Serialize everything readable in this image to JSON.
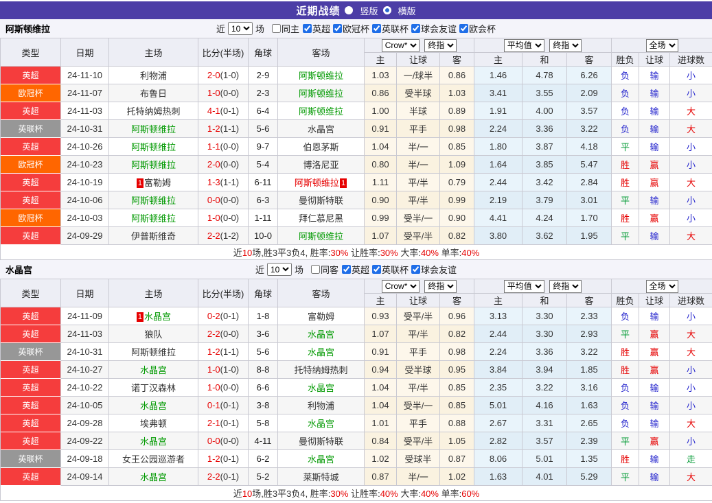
{
  "title_bar": {
    "title": "近期战绩",
    "vertical_label": "竖版",
    "horizontal_label": "横版",
    "vertical_selected": true
  },
  "table": {
    "columns": [
      "类型",
      "日期",
      "主场",
      "比分(半场)",
      "角球",
      "客场",
      "主",
      "让球",
      "客",
      "主",
      "和",
      "客",
      "胜负",
      "让球",
      "进球数"
    ],
    "dropdowns": [
      "Crow*",
      "终指",
      "平均值",
      "终指",
      "全场"
    ]
  },
  "filter_labels": {
    "near": "近",
    "matches": "场"
  },
  "colors": {
    "titlebar_purple": "#4c3da6",
    "epl_red": "#f53d3d",
    "ucl_orange": "#ff6600",
    "eflcup_gray": "#979797",
    "team_green": "#009900",
    "score_red": "#e60000",
    "result_blue": "#2323cd",
    "result_green": "#009933",
    "result_red": "#e60000",
    "handicap_col_bg": "#fdf7eb",
    "average_col_bg": "#e9f4fb"
  },
  "sections": [
    {
      "team": "阿斯顿维拉",
      "filter": {
        "count": "10",
        "same": "同主",
        "same_checked": false,
        "leagues": [
          {
            "label": "英超",
            "checked": true
          },
          {
            "label": "欧冠杯",
            "checked": true
          },
          {
            "label": "英联杯",
            "checked": true
          },
          {
            "label": "球会友谊",
            "checked": true
          },
          {
            "label": "欧会杯",
            "checked": true
          }
        ]
      },
      "rows": [
        {
          "league": "英超",
          "league_type": "epl",
          "date": "24-11-10",
          "home": {
            "name": "利物浦",
            "color": "dark"
          },
          "score_ft": "2-0",
          "score_ht": "(1-0)",
          "corner": "2-9",
          "away": {
            "name": "阿斯顿维拉",
            "color": "green"
          },
          "odds": [
            "1.03",
            "一/球半",
            "0.86"
          ],
          "avg": [
            "1.46",
            "4.78",
            "6.26"
          ],
          "results": [
            [
              "负",
              "blue"
            ],
            [
              "输",
              "blue"
            ],
            [
              "小",
              "blue"
            ]
          ]
        },
        {
          "league": "欧冠杯",
          "league_type": "ucl",
          "date": "24-11-07",
          "home": {
            "name": "布鲁日",
            "color": "dark"
          },
          "score_ft": "1-0",
          "score_ht": "(0-0)",
          "corner": "2-3",
          "away": {
            "name": "阿斯顿维拉",
            "color": "green"
          },
          "odds": [
            "0.86",
            "受半球",
            "1.03"
          ],
          "avg": [
            "3.41",
            "3.55",
            "2.09"
          ],
          "results": [
            [
              "负",
              "blue"
            ],
            [
              "输",
              "blue"
            ],
            [
              "小",
              "blue"
            ]
          ]
        },
        {
          "league": "英超",
          "league_type": "epl",
          "date": "24-11-03",
          "home": {
            "name": "托特纳姆热刺",
            "color": "dark"
          },
          "score_ft": "4-1",
          "score_ht": "(0-1)",
          "corner": "6-4",
          "away": {
            "name": "阿斯顿维拉",
            "color": "green"
          },
          "odds": [
            "1.00",
            "半球",
            "0.89"
          ],
          "avg": [
            "1.91",
            "4.00",
            "3.57"
          ],
          "results": [
            [
              "负",
              "blue"
            ],
            [
              "输",
              "blue"
            ],
            [
              "大",
              "red"
            ]
          ]
        },
        {
          "league": "英联杯",
          "league_type": "efl",
          "date": "24-10-31",
          "home": {
            "name": "阿斯顿维拉",
            "color": "green"
          },
          "score_ft": "1-2",
          "score_ht": "(1-1)",
          "corner": "5-6",
          "away": {
            "name": "水晶宫",
            "color": "dark"
          },
          "odds": [
            "0.91",
            "平手",
            "0.98"
          ],
          "avg": [
            "2.24",
            "3.36",
            "3.22"
          ],
          "results": [
            [
              "负",
              "blue"
            ],
            [
              "输",
              "blue"
            ],
            [
              "大",
              "red"
            ]
          ]
        },
        {
          "league": "英超",
          "league_type": "epl",
          "date": "24-10-26",
          "home": {
            "name": "阿斯顿维拉",
            "color": "green"
          },
          "score_ft": "1-1",
          "score_ht": "(0-0)",
          "corner": "9-7",
          "away": {
            "name": "伯恩茅斯",
            "color": "dark"
          },
          "odds": [
            "1.04",
            "半/一",
            "0.85"
          ],
          "avg": [
            "1.80",
            "3.87",
            "4.18"
          ],
          "results": [
            [
              "平",
              "green"
            ],
            [
              "输",
              "blue"
            ],
            [
              "小",
              "blue"
            ]
          ]
        },
        {
          "league": "欧冠杯",
          "league_type": "ucl",
          "date": "24-10-23",
          "home": {
            "name": "阿斯顿维拉",
            "color": "green"
          },
          "score_ft": "2-0",
          "score_ht": "(0-0)",
          "corner": "5-4",
          "away": {
            "name": "博洛尼亚",
            "color": "dark"
          },
          "odds": [
            "0.80",
            "半/一",
            "1.09"
          ],
          "avg": [
            "1.64",
            "3.85",
            "5.47"
          ],
          "results": [
            [
              "胜",
              "red"
            ],
            [
              "赢",
              "red"
            ],
            [
              "小",
              "blue"
            ]
          ]
        },
        {
          "league": "英超",
          "league_type": "epl",
          "date": "24-10-19",
          "home": {
            "name": "富勒姆",
            "color": "dark",
            "badge_before": "1"
          },
          "score_ft": "1-3",
          "score_ht": "(1-1)",
          "corner": "6-11",
          "away": {
            "name": "阿斯顿维拉",
            "color": "red",
            "badge_after": "1"
          },
          "odds": [
            "1.11",
            "平/半",
            "0.79"
          ],
          "avg": [
            "2.44",
            "3.42",
            "2.84"
          ],
          "results": [
            [
              "胜",
              "red"
            ],
            [
              "赢",
              "red"
            ],
            [
              "大",
              "red"
            ]
          ]
        },
        {
          "league": "英超",
          "league_type": "epl",
          "date": "24-10-06",
          "home": {
            "name": "阿斯顿维拉",
            "color": "green"
          },
          "score_ft": "0-0",
          "score_ht": "(0-0)",
          "corner": "6-3",
          "away": {
            "name": "曼彻斯特联",
            "color": "dark"
          },
          "odds": [
            "0.90",
            "平/半",
            "0.99"
          ],
          "avg": [
            "2.19",
            "3.79",
            "3.01"
          ],
          "results": [
            [
              "平",
              "green"
            ],
            [
              "输",
              "blue"
            ],
            [
              "小",
              "blue"
            ]
          ]
        },
        {
          "league": "欧冠杯",
          "league_type": "ucl",
          "date": "24-10-03",
          "home": {
            "name": "阿斯顿维拉",
            "color": "green"
          },
          "score_ft": "1-0",
          "score_ht": "(0-0)",
          "corner": "1-11",
          "away": {
            "name": "拜仁慕尼黑",
            "color": "dark"
          },
          "odds": [
            "0.99",
            "受半/一",
            "0.90"
          ],
          "avg": [
            "4.41",
            "4.24",
            "1.70"
          ],
          "results": [
            [
              "胜",
              "red"
            ],
            [
              "赢",
              "red"
            ],
            [
              "小",
              "blue"
            ]
          ]
        },
        {
          "league": "英超",
          "league_type": "epl",
          "date": "24-09-29",
          "home": {
            "name": "伊普斯维奇",
            "color": "dark"
          },
          "score_ft": "2-2",
          "score_ht": "(1-2)",
          "corner": "10-0",
          "away": {
            "name": "阿斯顿维拉",
            "color": "green"
          },
          "odds": [
            "1.07",
            "受平/半",
            "0.82"
          ],
          "avg": [
            "3.80",
            "3.62",
            "1.95"
          ],
          "results": [
            [
              "平",
              "green"
            ],
            [
              "输",
              "blue"
            ],
            [
              "大",
              "red"
            ]
          ]
        }
      ],
      "summary": [
        [
          "近",
          0
        ],
        [
          "10",
          1
        ],
        [
          "场,胜3平3负4, 胜率:",
          0
        ],
        [
          "30%",
          1
        ],
        [
          " 让胜率:",
          0
        ],
        [
          "30%",
          1
        ],
        [
          " 大率:",
          0
        ],
        [
          "40%",
          1
        ],
        [
          " 单率:",
          0
        ],
        [
          "40%",
          1
        ]
      ]
    },
    {
      "team": "水晶宫",
      "filter": {
        "count": "10",
        "same": "同客",
        "same_checked": false,
        "leagues": [
          {
            "label": "英超",
            "checked": true
          },
          {
            "label": "英联杯",
            "checked": true
          },
          {
            "label": "球会友谊",
            "checked": true
          }
        ]
      },
      "rows": [
        {
          "league": "英超",
          "league_type": "epl",
          "date": "24-11-09",
          "home": {
            "name": "水晶宫",
            "color": "green",
            "badge_before": "1"
          },
          "score_ft": "0-2",
          "score_ht": "(0-1)",
          "corner": "1-8",
          "away": {
            "name": "富勒姆",
            "color": "dark"
          },
          "odds": [
            "0.93",
            "受平/半",
            "0.96"
          ],
          "avg": [
            "3.13",
            "3.30",
            "2.33"
          ],
          "results": [
            [
              "负",
              "blue"
            ],
            [
              "输",
              "blue"
            ],
            [
              "小",
              "blue"
            ]
          ]
        },
        {
          "league": "英超",
          "league_type": "epl",
          "date": "24-11-03",
          "home": {
            "name": "狼队",
            "color": "dark"
          },
          "score_ft": "2-2",
          "score_ht": "(0-0)",
          "corner": "3-6",
          "away": {
            "name": "水晶宫",
            "color": "green"
          },
          "odds": [
            "1.07",
            "平/半",
            "0.82"
          ],
          "avg": [
            "2.44",
            "3.30",
            "2.93"
          ],
          "results": [
            [
              "平",
              "green"
            ],
            [
              "赢",
              "red"
            ],
            [
              "大",
              "red"
            ]
          ]
        },
        {
          "league": "英联杯",
          "league_type": "efl",
          "date": "24-10-31",
          "home": {
            "name": "阿斯顿维拉",
            "color": "dark"
          },
          "score_ft": "1-2",
          "score_ht": "(1-1)",
          "corner": "5-6",
          "away": {
            "name": "水晶宫",
            "color": "green"
          },
          "odds": [
            "0.91",
            "平手",
            "0.98"
          ],
          "avg": [
            "2.24",
            "3.36",
            "3.22"
          ],
          "results": [
            [
              "胜",
              "red"
            ],
            [
              "赢",
              "red"
            ],
            [
              "大",
              "red"
            ]
          ]
        },
        {
          "league": "英超",
          "league_type": "epl",
          "date": "24-10-27",
          "home": {
            "name": "水晶宫",
            "color": "green"
          },
          "score_ft": "1-0",
          "score_ht": "(1-0)",
          "corner": "8-8",
          "away": {
            "name": "托特纳姆热刺",
            "color": "dark"
          },
          "odds": [
            "0.94",
            "受半球",
            "0.95"
          ],
          "avg": [
            "3.84",
            "3.94",
            "1.85"
          ],
          "results": [
            [
              "胜",
              "red"
            ],
            [
              "赢",
              "red"
            ],
            [
              "小",
              "blue"
            ]
          ]
        },
        {
          "league": "英超",
          "league_type": "epl",
          "date": "24-10-22",
          "home": {
            "name": "诺丁汉森林",
            "color": "dark"
          },
          "score_ft": "1-0",
          "score_ht": "(0-0)",
          "corner": "6-6",
          "away": {
            "name": "水晶宫",
            "color": "green"
          },
          "odds": [
            "1.04",
            "平/半",
            "0.85"
          ],
          "avg": [
            "2.35",
            "3.22",
            "3.16"
          ],
          "results": [
            [
              "负",
              "blue"
            ],
            [
              "输",
              "blue"
            ],
            [
              "小",
              "blue"
            ]
          ]
        },
        {
          "league": "英超",
          "league_type": "epl",
          "date": "24-10-05",
          "home": {
            "name": "水晶宫",
            "color": "green"
          },
          "score_ft": "0-1",
          "score_ht": "(0-1)",
          "corner": "3-8",
          "away": {
            "name": "利物浦",
            "color": "dark"
          },
          "odds": [
            "1.04",
            "受半/一",
            "0.85"
          ],
          "avg": [
            "5.01",
            "4.16",
            "1.63"
          ],
          "results": [
            [
              "负",
              "blue"
            ],
            [
              "输",
              "blue"
            ],
            [
              "小",
              "blue"
            ]
          ]
        },
        {
          "league": "英超",
          "league_type": "epl",
          "date": "24-09-28",
          "home": {
            "name": "埃弗顿",
            "color": "dark"
          },
          "score_ft": "2-1",
          "score_ht": "(0-1)",
          "corner": "5-8",
          "away": {
            "name": "水晶宫",
            "color": "green"
          },
          "odds": [
            "1.01",
            "平手",
            "0.88"
          ],
          "avg": [
            "2.67",
            "3.31",
            "2.65"
          ],
          "results": [
            [
              "负",
              "blue"
            ],
            [
              "输",
              "blue"
            ],
            [
              "大",
              "red"
            ]
          ]
        },
        {
          "league": "英超",
          "league_type": "epl",
          "date": "24-09-22",
          "home": {
            "name": "水晶宫",
            "color": "green"
          },
          "score_ft": "0-0",
          "score_ht": "(0-0)",
          "corner": "4-11",
          "away": {
            "name": "曼彻斯特联",
            "color": "dark"
          },
          "odds": [
            "0.84",
            "受平/半",
            "1.05"
          ],
          "avg": [
            "2.82",
            "3.57",
            "2.39"
          ],
          "results": [
            [
              "平",
              "green"
            ],
            [
              "赢",
              "red"
            ],
            [
              "小",
              "blue"
            ]
          ]
        },
        {
          "league": "英联杯",
          "league_type": "efl",
          "date": "24-09-18",
          "home": {
            "name": "女王公园巡游者",
            "color": "dark"
          },
          "score_ft": "1-2",
          "score_ht": "(0-1)",
          "corner": "6-2",
          "away": {
            "name": "水晶宫",
            "color": "green"
          },
          "odds": [
            "1.02",
            "受球半",
            "0.87"
          ],
          "avg": [
            "8.06",
            "5.01",
            "1.35"
          ],
          "results": [
            [
              "胜",
              "red"
            ],
            [
              "输",
              "blue"
            ],
            [
              "走",
              "green"
            ]
          ]
        },
        {
          "league": "英超",
          "league_type": "epl",
          "date": "24-09-14",
          "home": {
            "name": "水晶宫",
            "color": "green"
          },
          "score_ft": "2-2",
          "score_ht": "(0-1)",
          "corner": "5-2",
          "away": {
            "name": "莱斯特城",
            "color": "dark"
          },
          "odds": [
            "0.87",
            "半/一",
            "1.02"
          ],
          "avg": [
            "1.63",
            "4.01",
            "5.29"
          ],
          "results": [
            [
              "平",
              "green"
            ],
            [
              "输",
              "blue"
            ],
            [
              "大",
              "red"
            ]
          ]
        }
      ],
      "summary": [
        [
          "近",
          0
        ],
        [
          "10",
          1
        ],
        [
          "场,胜3平3负4, 胜率:",
          0
        ],
        [
          "30%",
          1
        ],
        [
          " 让胜率:",
          0
        ],
        [
          "40%",
          1
        ],
        [
          " 大率:",
          0
        ],
        [
          "40%",
          1
        ],
        [
          " 单率:",
          0
        ],
        [
          "60%",
          1
        ]
      ]
    }
  ]
}
